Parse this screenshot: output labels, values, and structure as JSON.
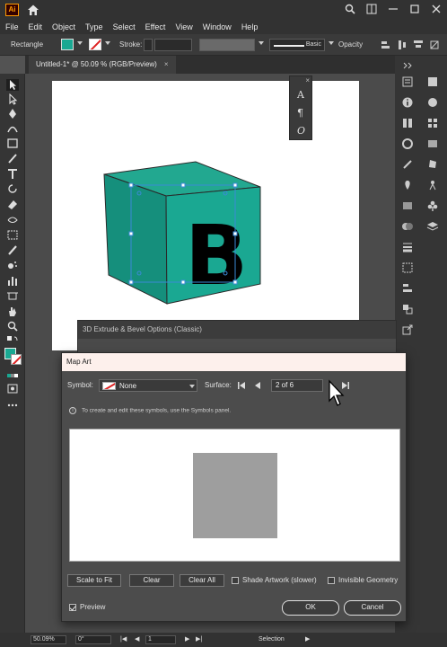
{
  "app": {
    "logo": "Ai"
  },
  "titlebar_icons": [
    "home-icon",
    "search-icon",
    "arrange-documents-icon",
    "minimize-icon",
    "maximize-icon",
    "close-icon"
  ],
  "menu": [
    "File",
    "Edit",
    "Object",
    "Type",
    "Select",
    "Effect",
    "View",
    "Window",
    "Help"
  ],
  "control": {
    "selection_type": "Rectangle",
    "fill_color": "#1aa892",
    "stroke_label": "Stroke:",
    "brush_label": "Basic",
    "opacity_label": "Opacity"
  },
  "document": {
    "tab_title": "Untitled-1* @ 50.09 % (RGB/Preview)",
    "close": "×"
  },
  "artwork": {
    "cube_letter": "B",
    "cube_front_color": "#1aa892",
    "cube_side_color": "#158f7c",
    "cube_top_color": "#22a890"
  },
  "char_panel": {
    "glyphs": [
      "A",
      "¶",
      "O"
    ]
  },
  "extrude_dialog": {
    "title": "3D Extrude & Bevel Options (Classic)"
  },
  "map_art": {
    "title": "Map Art",
    "symbol_label": "Symbol:",
    "symbol_value": "None",
    "surface_label": "Surface:",
    "surface_value": "2 of 6",
    "info": "To create and edit these symbols, use the Symbols panel.",
    "buttons": {
      "scale_to_fit": "Scale to Fit",
      "clear": "Clear",
      "clear_all": "Clear All",
      "ok": "OK",
      "cancel": "Cancel"
    },
    "shade_artwork": "Shade Artwork (slower)",
    "invisible_geometry": "Invisible Geometry",
    "preview": "Preview",
    "preview_checked": true
  },
  "status": {
    "zoom": "50.09%",
    "rotation": "0°",
    "artboard": "1",
    "tool": "Selection"
  }
}
